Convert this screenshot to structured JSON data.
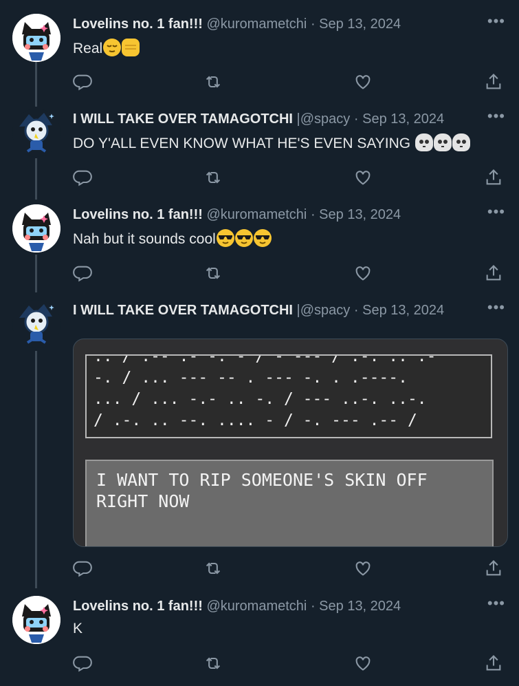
{
  "tweets": [
    {
      "name": "Lovelins no. 1 fan!!!",
      "handle": "@kuromametchi",
      "date": "Sep 13, 2024",
      "text": "Real",
      "emojis": [
        "relieved-face",
        "raised-fist"
      ]
    },
    {
      "name": "I WILL TAKE OVER TAMAGOTCHI",
      "handle": "@spacy",
      "date": "Sep 13, 2024",
      "text": "DO Y'ALL EVEN KNOW WHAT HE'S EVEN SAYING",
      "emojis": [
        "skull",
        "skull",
        "skull"
      ]
    },
    {
      "name": "Lovelins no. 1 fan!!!",
      "handle": "@kuromametchi",
      "date": "Sep 13, 2024",
      "text": "Nah but it sounds cool",
      "emojis": [
        "sunglasses-face",
        "sunglasses-face",
        "sunglasses-face"
      ]
    },
    {
      "name": "I WILL TAKE OVER TAMAGOTCHI",
      "handle": "@spacy",
      "date": "Sep 13, 2024",
      "media": {
        "morse_lines": [
          ".. / .-- .- -. - / - --- / .-. .. .-",
          "-. / ... --- -- . --- -. . .----.",
          "... / ... -.- .. -. / --- ..-. ..-.",
          "/ .-. .. --. .... - / -. --- .-- /"
        ],
        "translation_lines": [
          "I WANT TO RIP SOMEONE'S SKIN OFF",
          "RIGHT NOW"
        ]
      }
    },
    {
      "name": "Lovelins no. 1 fan!!!",
      "handle": "@kuromametchi",
      "date": "Sep 13, 2024",
      "text": "K"
    }
  ],
  "ui": {
    "separator": "·",
    "more_glyph": "•••",
    "handle_divider": "|"
  },
  "icons": [
    "reply-icon",
    "retweet-icon",
    "like-icon",
    "share-icon",
    "more-icon"
  ],
  "colors": {
    "background": "#15202b",
    "text": "#e7e9ea",
    "secondary": "#8b98a5",
    "thread_line": "#3d4a56"
  }
}
